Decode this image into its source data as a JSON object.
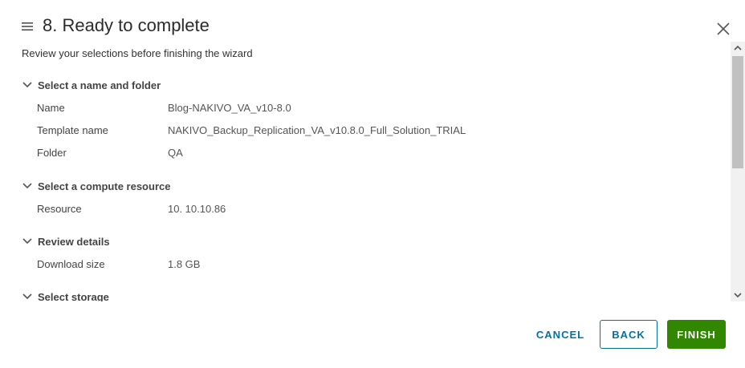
{
  "header": {
    "title": "8. Ready to complete",
    "subtitle": "Review your selections before finishing the wizard",
    "menu_icon": "hamburger-menu-icon",
    "close_icon": "close-icon"
  },
  "sections": [
    {
      "title": "Select a name and folder",
      "rows": [
        {
          "label": "Name",
          "value": "Blog-NAKIVO_VA_v10-8.0"
        },
        {
          "label": "Template name",
          "value": "NAKIVO_Backup_Replication_VA_v10.8.0_Full_Solution_TRIAL"
        },
        {
          "label": "Folder",
          "value": "QA"
        }
      ]
    },
    {
      "title": "Select a compute resource",
      "rows": [
        {
          "label": "Resource",
          "value": "10. 10.10.86"
        }
      ]
    },
    {
      "title": "Review details",
      "rows": [
        {
          "label": "Download size",
          "value": "1.8 GB"
        }
      ]
    },
    {
      "title": "Select storage",
      "rows": []
    }
  ],
  "footer": {
    "cancel_label": "CANCEL",
    "back_label": "BACK",
    "finish_label": "FINISH"
  },
  "colors": {
    "accent": "#0072a3",
    "finish": "#318700",
    "text": "#333333"
  }
}
